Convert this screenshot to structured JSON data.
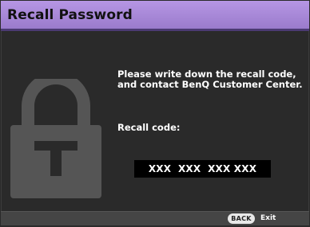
{
  "window": {
    "title": "Recall Password"
  },
  "message": {
    "instruction": "Please write down the recall code, and contact BenQ Customer Center.",
    "code_label": "Recall code:",
    "code_value": "XXX  XXX  XXX XXX"
  },
  "footer": {
    "back_button": "BACK",
    "exit_label": "Exit"
  },
  "colors": {
    "title_bar": "#a98ad9",
    "background": "#2a2a2a",
    "lock_icon": "#555555",
    "code_box": "#000000"
  },
  "icons": {
    "lock": "lock-icon"
  }
}
